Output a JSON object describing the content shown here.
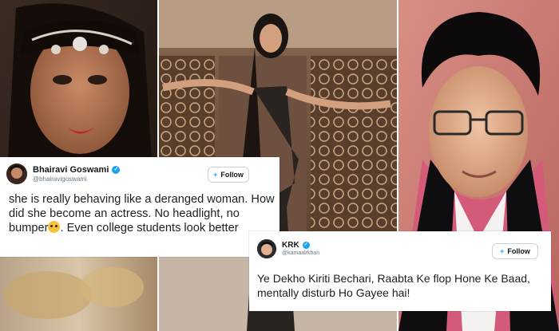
{
  "tweets": [
    {
      "name": "Bhairavi Goswami",
      "handle": "@bhairavigoswami",
      "follow_label": "Follow",
      "text_before_emoji": "she is really behaving like a deranged woman. How did she become an actress. No headlight, no bumper",
      "emoji": "flushed-face-emoji",
      "text_after_emoji": ". Even college students look better"
    },
    {
      "name": "KRK",
      "handle": "@kamaalrkhan",
      "follow_label": "Follow",
      "text": "Ye Dekho Kiriti Bechari, Raabta Ke flop Hone Ke Baad, mentally disturb Ho Gayee hai!"
    }
  ],
  "icons": {
    "verified": "verified-badge-icon",
    "follow": "add-user-icon"
  },
  "colors": {
    "twitter_blue": "#1da1f2",
    "handle_gray": "#657786"
  }
}
